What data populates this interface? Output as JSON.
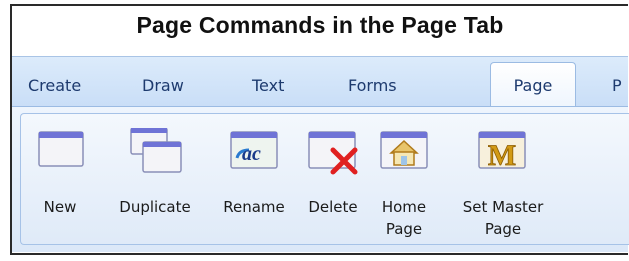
{
  "title": "Page Commands in the Page Tab",
  "tabs": [
    {
      "label": "Create"
    },
    {
      "label": "Draw"
    },
    {
      "label": "Text"
    },
    {
      "label": "Forms"
    },
    {
      "label": "Page",
      "active": true
    },
    {
      "label": "P"
    }
  ],
  "commands": [
    {
      "label": "New",
      "icon": "new-page-icon"
    },
    {
      "label": "Duplicate",
      "icon": "duplicate-page-icon"
    },
    {
      "label": "Rename",
      "icon": "rename-page-icon"
    },
    {
      "label": "Delete",
      "icon": "delete-page-icon"
    },
    {
      "label": "Home\nPage",
      "icon": "home-page-icon"
    },
    {
      "label": "Set Master\nPage",
      "icon": "set-master-page-icon"
    }
  ],
  "icon_glyphs": {
    "rename": "ac",
    "master": "M"
  },
  "colors": {
    "accent": "#1d3a6e",
    "delete_x": "#e02020",
    "master_gold": "#d29a14",
    "window_titlebar": "#6f73d6"
  }
}
